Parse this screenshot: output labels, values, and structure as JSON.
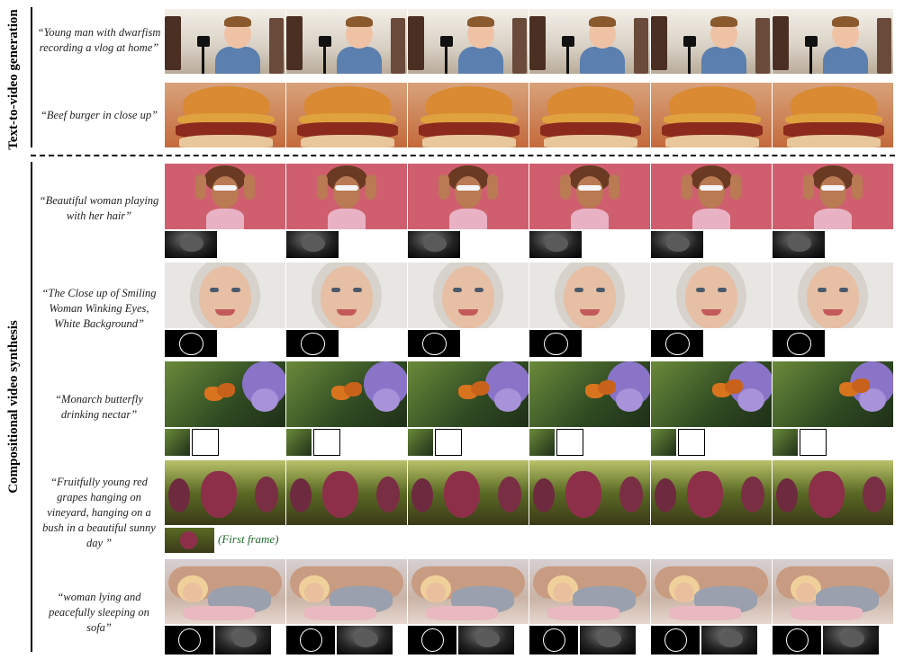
{
  "sections": [
    {
      "label": "Text-to-video generation"
    },
    {
      "label": "Compositional video synthesis"
    }
  ],
  "rows": [
    {
      "id": "vlog",
      "caption": "“Young man with dwarfism recording a vlog at home”",
      "frame_icon": "boy-recording-vlog",
      "conditions": []
    },
    {
      "id": "burger",
      "caption": "“Beef burger in close up”",
      "frame_icon": "beef-burger",
      "conditions": []
    },
    {
      "id": "hair",
      "caption": "“Beautiful woman playing with her hair”",
      "frame_icon": "woman-sunglasses-hair",
      "conditions": [
        "depth-map"
      ]
    },
    {
      "id": "smile",
      "caption": "“The Close up of Smiling Woman Winking Eyes, White Background”",
      "frame_icon": "woman-face-closeup",
      "conditions": [
        "sketch-map"
      ]
    },
    {
      "id": "butterfly",
      "caption": "“Monarch butterfly drinking nectar”",
      "frame_icon": "monarch-butterfly",
      "conditions": [
        "motion-mask"
      ]
    },
    {
      "id": "grapes",
      "caption": "“Fruitfully young red grapes hanging on vineyard, hanging on a bush in a beautiful sunny day ”",
      "frame_icon": "red-grapes",
      "conditions": [
        "first-frame"
      ],
      "first_frame_label": "(First frame)"
    },
    {
      "id": "sofa",
      "caption": "“woman lying and peacefully sleeping on sofa”",
      "frame_icon": "woman-sleeping-sofa",
      "conditions": [
        "sketch-map",
        "depth-map"
      ]
    }
  ],
  "colors": {
    "vlog_bg": "#d9d4cc",
    "burger_bg": "#b9562f",
    "hair_bg": "#cf5f6e",
    "smile_bg": "#e8e6e3",
    "butterfly_bg": "#3d5a2a",
    "grapes_bg": "#6d6a2e",
    "sofa_bg": "#cfc3c2",
    "first_frame_label": "#1f6b2a"
  }
}
